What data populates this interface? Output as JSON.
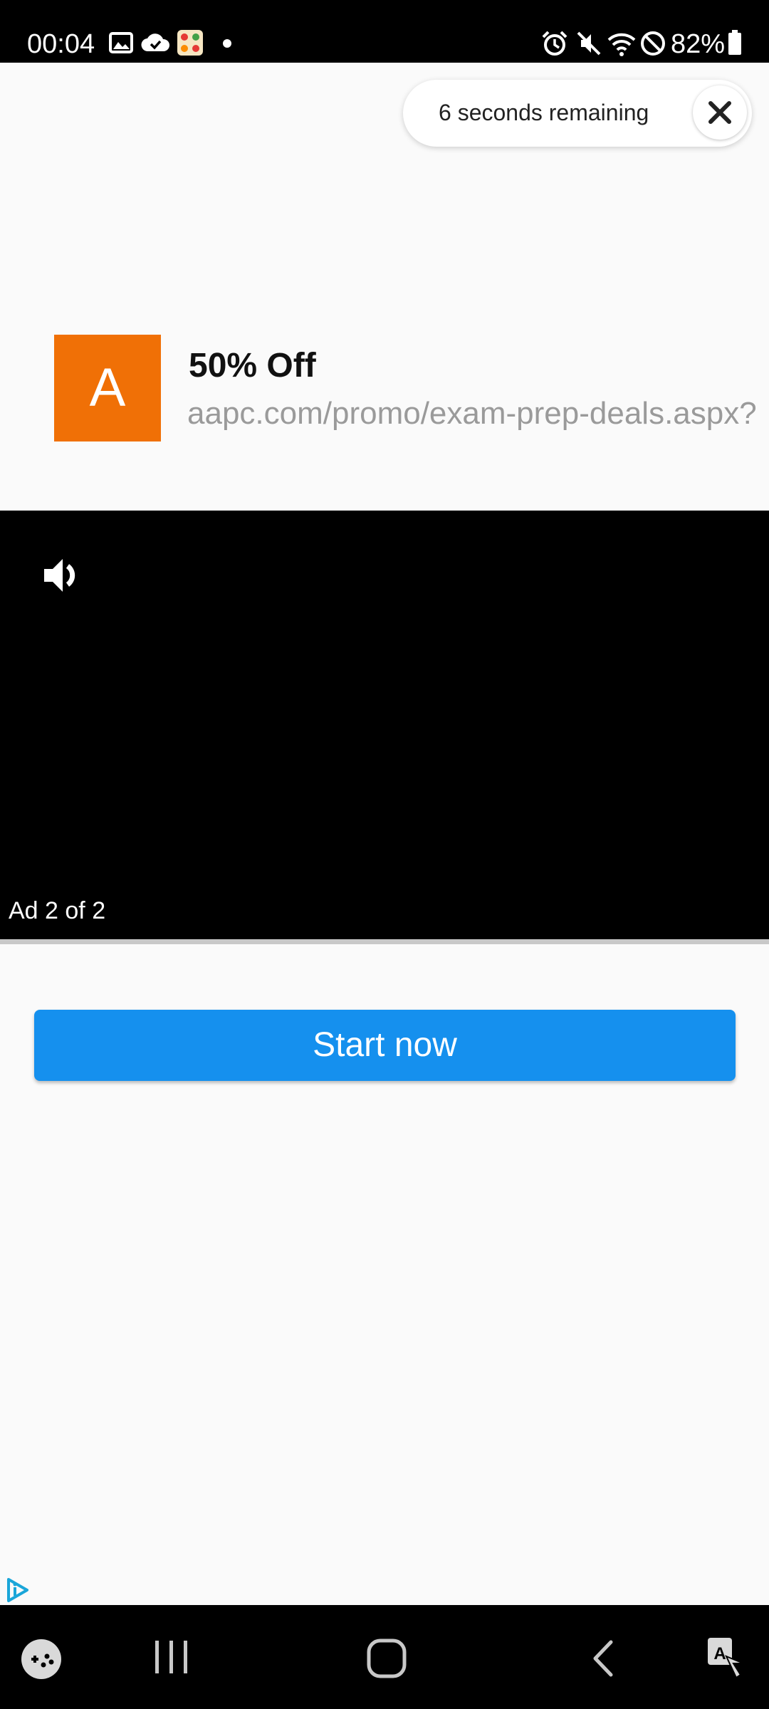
{
  "status_bar": {
    "time": "00:04",
    "battery": "82%",
    "left_icons": [
      "gallery-icon",
      "cloud-check-icon",
      "app-notification-icon",
      "dot-icon"
    ],
    "right_icons": [
      "alarm-icon",
      "mute-icon",
      "wifi-icon",
      "do-not-disturb-icon",
      "battery-icon"
    ]
  },
  "countdown": {
    "text": "6 seconds remaining",
    "close_icon": "close-icon"
  },
  "ad": {
    "logo_letter": "A",
    "logo_color": "#f07006",
    "headline": "50% Off",
    "url": "aapc.com/promo/exam-prep-deals.aspx?"
  },
  "video": {
    "counter": "Ad 2 of 2",
    "volume_icon": "volume-icon"
  },
  "cta": {
    "label": "Start now",
    "color": "#1590ee"
  },
  "nav_bar": {
    "icons": [
      "game-launcher-icon",
      "recent-apps-icon",
      "home-icon",
      "back-icon",
      "accessibility-icon"
    ]
  },
  "adchoices_icon": "adchoices-icon"
}
